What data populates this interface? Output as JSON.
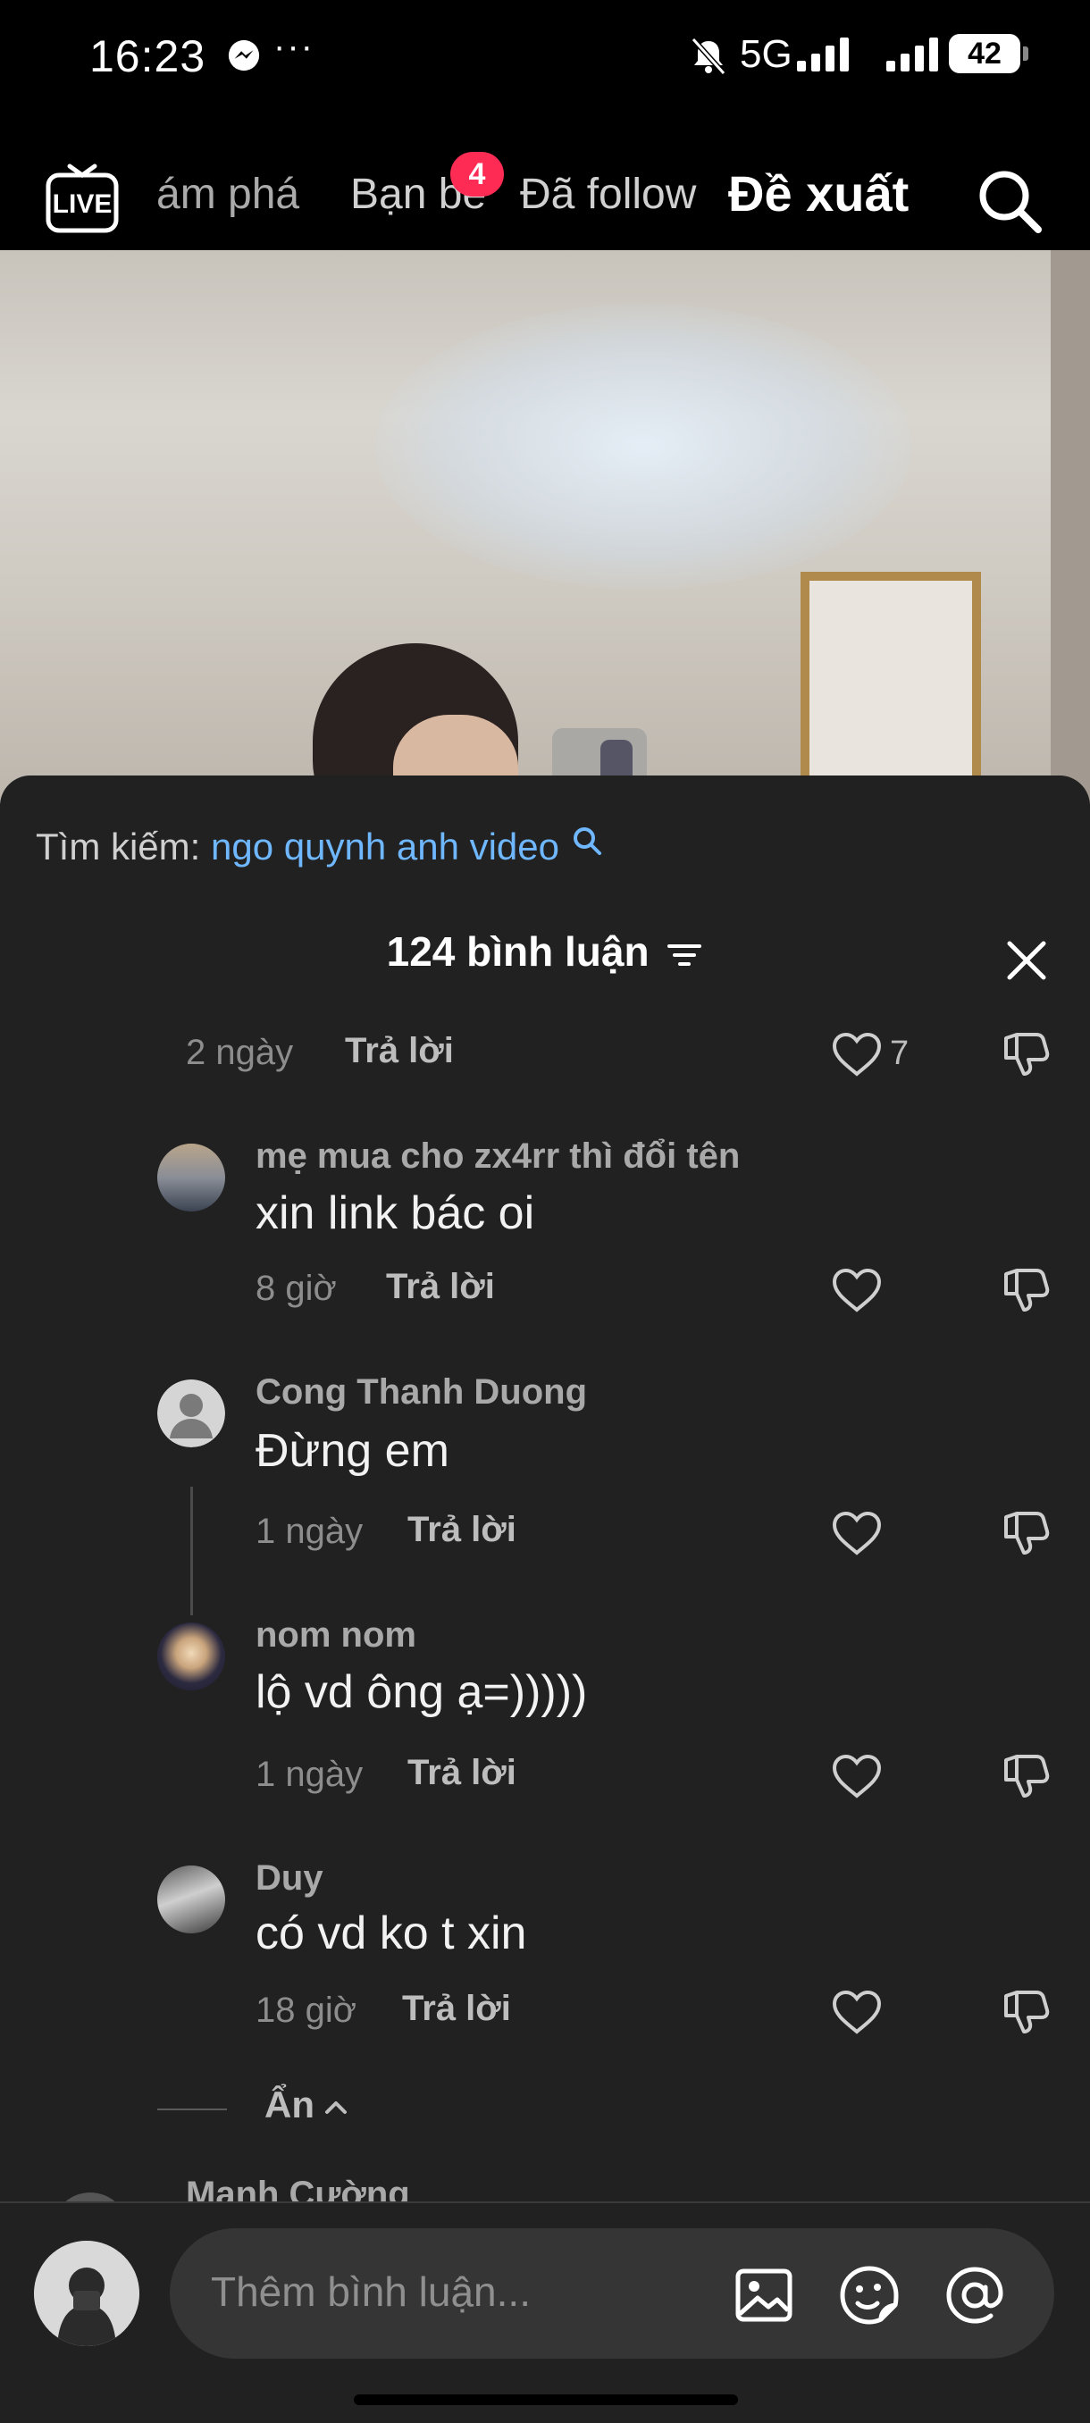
{
  "status_bar": {
    "time": "16:23",
    "dots": "···",
    "network": "5G",
    "battery": "42"
  },
  "top_nav": {
    "tabs": [
      "ám phá",
      "Bạn bè",
      "Đã follow",
      "Đề xuất"
    ],
    "active_tab": "Đề xuất",
    "friends_badge": "4"
  },
  "comments": {
    "search_label": "Tìm kiếm:",
    "search_keyword": "ngo quynh anh video",
    "header": "124 bình luận",
    "reply_label": "Trả lời",
    "hide_label": "Ẩn",
    "top_row": {
      "time": "2 ngày",
      "likes": "7"
    },
    "items": [
      {
        "username": "mẹ mua cho zx4rr thì đổi tên",
        "text": "xin link bác oi",
        "time": "8 giờ"
      },
      {
        "username": "Cong Thanh Duong",
        "text": "Đừng em",
        "time": "1 ngày"
      },
      {
        "username": "nom nom",
        "text": "lộ vd ông ạ=)))))",
        "time": "1 ngày"
      },
      {
        "username": "Duy",
        "text": "có vd ko t xin",
        "time": "18 giờ"
      }
    ],
    "next_username": "Mạnh Cường"
  },
  "input_bar": {
    "placeholder": "Thêm bình luận..."
  },
  "colors": {
    "panel_bg": "#212121",
    "link_blue": "#6fb7ff",
    "badge_red": "#fe2c55"
  }
}
